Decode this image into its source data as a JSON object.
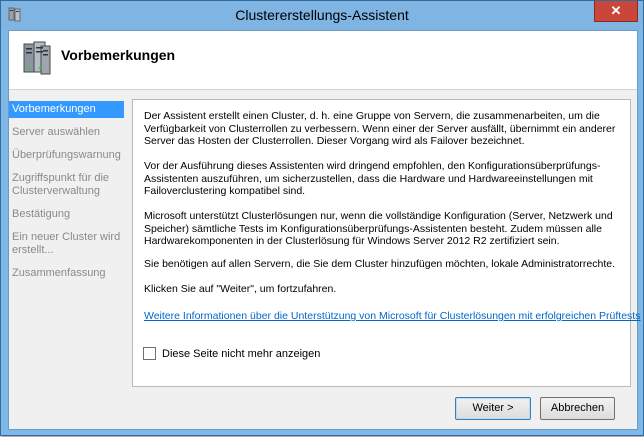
{
  "window": {
    "title": "Clustererstellungs-Assistent",
    "close_label": "✕"
  },
  "header": {
    "title": "Vorbemerkungen"
  },
  "nav": {
    "items": [
      {
        "label": "Vorbemerkungen"
      },
      {
        "label": "Server auswählen"
      },
      {
        "label": "Überprüfungswarnung"
      },
      {
        "label": "Zugriffspunkt für die Clusterverwaltung"
      },
      {
        "label": "Bestätigung"
      },
      {
        "label": "Ein neuer Cluster wird erstellt..."
      },
      {
        "label": "Zusammenfassung"
      }
    ]
  },
  "content": {
    "paragraphs": [
      "Der Assistent erstellt einen Cluster, d. h. eine Gruppe von Servern, die zusammenarbeiten, um die Verfügbarkeit von Clusterrollen zu verbessern. Wenn einer der Server ausfällt, übernimmt ein anderer Server das Hosten der Clusterrollen. Dieser Vorgang wird als Failover bezeichnet.",
      "Vor der Ausführung dieses Assistenten wird dringend empfohlen, den Konfigurationsüberprüfungs-Assistenten auszuführen, um sicherzustellen, dass die Hardware und Hardwareeinstellungen mit Failoverclustering kompatibel sind.",
      "Microsoft unterstützt Clusterlösungen nur, wenn die vollständige Konfiguration (Server, Netzwerk und Speicher) sämtliche Tests im Konfigurationsüberprüfungs-Assistenten besteht. Zudem müssen alle Hardwarekomponenten in der Clusterlösung für Windows Server 2012 R2 zertifiziert sein.",
      "Sie benötigen auf allen Servern, die Sie dem Cluster hinzufügen möchten, lokale Administratorrechte.",
      "Klicken Sie auf \"Weiter\", um fortzufahren."
    ],
    "link": "Weitere Informationen über die Unterstützung von Microsoft für Clusterlösungen mit erfolgreichen Prüftests",
    "checkbox_label": "Diese Seite nicht mehr anzeigen",
    "checkbox_checked": false
  },
  "buttons": {
    "next": "Weiter >",
    "cancel": "Abbrechen"
  },
  "colors": {
    "nav_active": "#3399ff",
    "link": "#0066cc",
    "title_bar": "#7fb4e3",
    "close_button": "#c9463a"
  }
}
